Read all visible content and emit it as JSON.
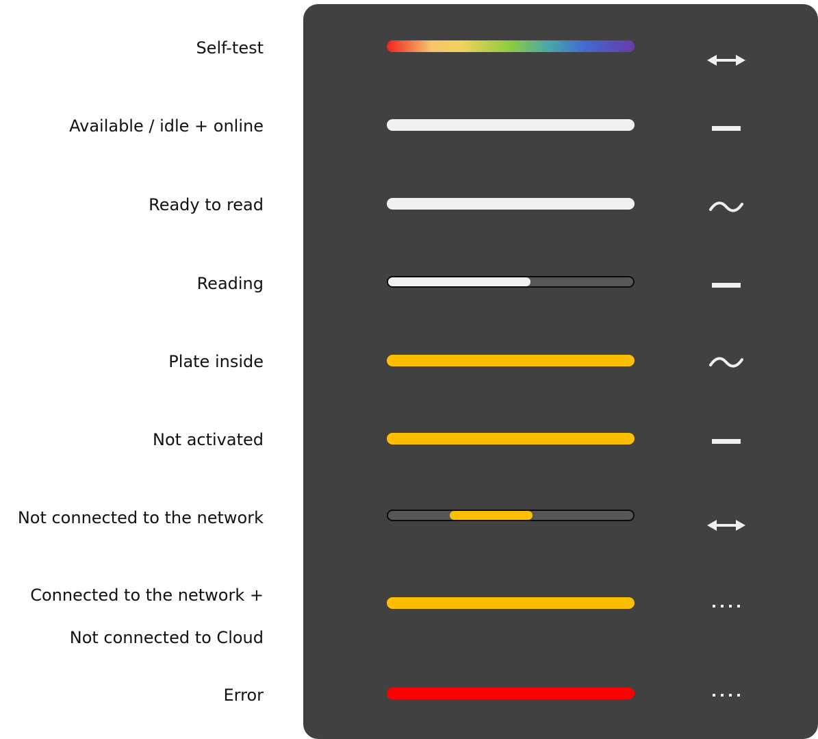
{
  "colors": {
    "panel": "#414141",
    "white": "#f0f0f0",
    "yellow": "#fcbf00",
    "red": "#ff0000",
    "track": "#565656"
  },
  "rows": [
    {
      "label": "Self-test",
      "bar": "rainbow",
      "icon": "double-arrow-icon"
    },
    {
      "label": "Available / idle + online",
      "bar": "white",
      "icon": "dash-icon"
    },
    {
      "label": "Ready to read",
      "bar": "white",
      "icon": "tilde-icon"
    },
    {
      "label": "Reading",
      "bar": "white-partial",
      "progress": 0.58,
      "icon": "dash-icon"
    },
    {
      "label": "Plate inside",
      "bar": "yellow",
      "icon": "tilde-icon"
    },
    {
      "label": "Not activated",
      "bar": "yellow",
      "icon": "dash-icon"
    },
    {
      "label": "Not connected to the network",
      "bar": "yellow-segment",
      "segment_start": 0.25,
      "segment_end": 0.59,
      "icon": "double-arrow-icon"
    },
    {
      "label_line1": "Connected to the network +",
      "label_line2": "Not connected to Cloud",
      "bar": "yellow",
      "icon": "dots-icon"
    },
    {
      "label": "Error",
      "bar": "red",
      "icon": "dots-icon"
    }
  ]
}
